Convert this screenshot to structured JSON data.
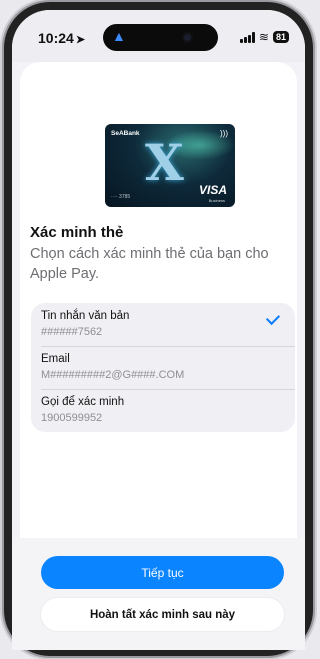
{
  "status_bar": {
    "time": "10:24",
    "location_arrow": "➤",
    "battery": "81"
  },
  "card": {
    "bank_name": "SeABank",
    "brand_glyph": "X",
    "last_digits": "···· 3785",
    "network": "VISA",
    "network_sub": "Business"
  },
  "verify": {
    "title": "Xác minh thẻ",
    "subtitle": "Chọn cách xác minh thẻ của bạn cho Apple Pay."
  },
  "options": [
    {
      "label": "Tin nhắn văn bản",
      "value": "######7562",
      "selected": true
    },
    {
      "label": "Email",
      "value": "M#########2@G####.COM",
      "selected": false
    },
    {
      "label": "Gọi để xác minh",
      "value": "1900599952",
      "selected": false
    }
  ],
  "actions": {
    "continue_label": "Tiếp tục",
    "later_label": "Hoàn tất xác minh sau này"
  },
  "colors": {
    "accent": "#0a84ff",
    "check": "#0a7cff"
  }
}
